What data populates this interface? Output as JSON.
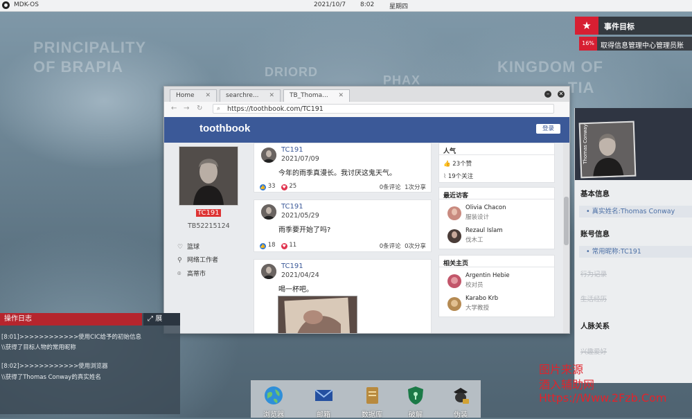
{
  "topbar": {
    "os_name": "MDK-OS",
    "date": "2021/10/7",
    "time": "8:02",
    "weekday": "星期四"
  },
  "map": {
    "labels": [
      "PRINCIPALITY",
      "OF BRAPIA",
      "DRIORD",
      "PHAX",
      "KINGDOM OF",
      "TIA"
    ]
  },
  "event": {
    "title": "事件目标",
    "progress": "16%",
    "description": "取得信息管理中心管理员账"
  },
  "browser": {
    "tabs": [
      {
        "label": "Home"
      },
      {
        "label": "searchre..."
      },
      {
        "label": "TB_Thoma..."
      }
    ],
    "url": "https://toothbook.com/TC191",
    "site_logo": "toothbook",
    "login_label": "登录"
  },
  "profile": {
    "name": "TC191",
    "id": "TB52215124",
    "info": [
      {
        "icon": "heart-icon",
        "text": "篮球"
      },
      {
        "icon": "tie-icon",
        "text": "网络工作者"
      },
      {
        "icon": "location-icon",
        "text": "高蒂市"
      }
    ]
  },
  "posts": [
    {
      "user": "TC191",
      "date": "2021/07/09",
      "text": "今年的雨季真漫长。我讨厌这鬼天气。",
      "likes": "33",
      "loves": "25",
      "comments": "0条评论",
      "shares": "1次分享"
    },
    {
      "user": "TC191",
      "date": "2021/05/29",
      "text": "雨季要开始了吗?",
      "likes": "18",
      "loves": "11",
      "comments": "0条评论",
      "shares": "0次分享"
    },
    {
      "user": "TC191",
      "date": "2021/04/24",
      "text": "喝一杯吧。"
    }
  ],
  "side": {
    "popularity": {
      "title": "人气",
      "likes": "23个赞",
      "follows": "19个关注"
    },
    "visitors": {
      "title": "最近访客",
      "people": [
        {
          "name": "Olivia Chacon",
          "role": "服装设计"
        },
        {
          "name": "Rezaul Islam",
          "role": "伐木工"
        }
      ]
    },
    "related": {
      "title": "相关主页",
      "people": [
        {
          "name": "Argentin Hebie",
          "role": "校对员"
        },
        {
          "name": "Karabo Krb",
          "role": "大学教授"
        }
      ]
    }
  },
  "rpanel": {
    "vertical_name": "Thomas Conway",
    "basic_title": "基本信息",
    "real_name": "• 真实姓名:Thomas Conway",
    "account_title": "账号信息",
    "nickname": "• 常用昵称:TC191",
    "dim1": "行为记录",
    "dim2": "生活经历",
    "relations_title": "人脉关系",
    "dim3": "兴趣爱好"
  },
  "oplog": {
    "title": "操作日志",
    "expand": "展",
    "lines": [
      "[8:01]>>>>>>>>>>>>使用CIC给予的初始信息",
      "\\\\获得了目标人物的常用昵称",
      "[8:02]>>>>>>>>>>>>使用浏览器",
      "\\\\获得了Thomas Conway的真实姓名"
    ]
  },
  "dock": [
    {
      "label": "浏览器",
      "icon": "globe-icon"
    },
    {
      "label": "邮箱",
      "icon": "mail-icon"
    },
    {
      "label": "数据库",
      "icon": "database-icon"
    },
    {
      "label": "破解",
      "icon": "shield-icon"
    },
    {
      "label": "伪装",
      "icon": "disguise-icon"
    }
  ],
  "watermark": {
    "line1": "图片来源",
    "line2": "酒入辅助网",
    "line3": "Https://Www.2Fzb.Com"
  }
}
